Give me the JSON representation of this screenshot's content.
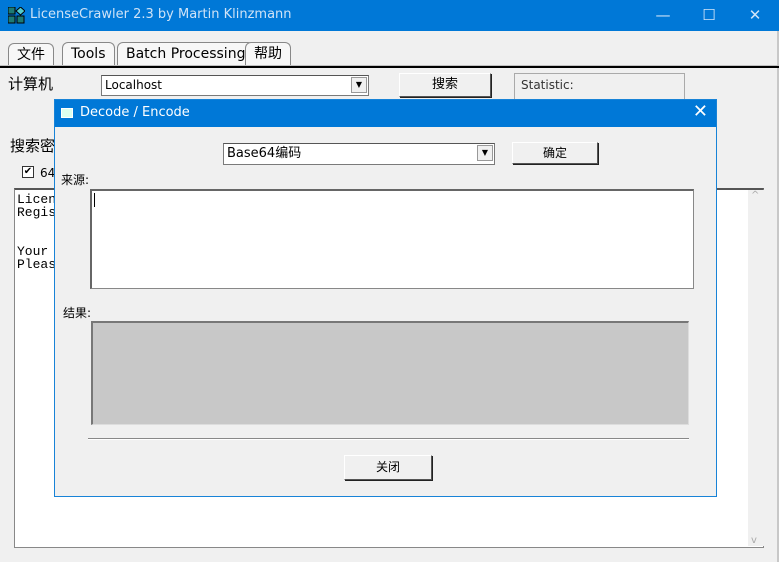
{
  "window": {
    "title": "LicenseCrawler 2.3 by Martin Klinzmann",
    "minimize": "—",
    "maximize": "☐",
    "close": "✕"
  },
  "tabs": [
    {
      "label": "文件"
    },
    {
      "label": "Tools"
    },
    {
      "label": "Batch Processing"
    },
    {
      "label": "帮助"
    }
  ],
  "main": {
    "computer_label": "计算机",
    "computer_value": "Localhost",
    "search_button": "搜索",
    "statistic_label": "Statistic:",
    "search_key_label": "搜索密",
    "checkbox_label": "64",
    "checkbox_checked": true,
    "output_lines": [
      "Licen",
      "Regis",
      "",
      "",
      "Your ",
      "Pleas"
    ]
  },
  "dialog": {
    "title": "Decode / Encode",
    "mode_value": "Base64编码",
    "ok_button": "确定",
    "source_label": "来源:",
    "source_value": "",
    "result_label": "结果:",
    "result_value": "",
    "close_button": "关闭"
  }
}
